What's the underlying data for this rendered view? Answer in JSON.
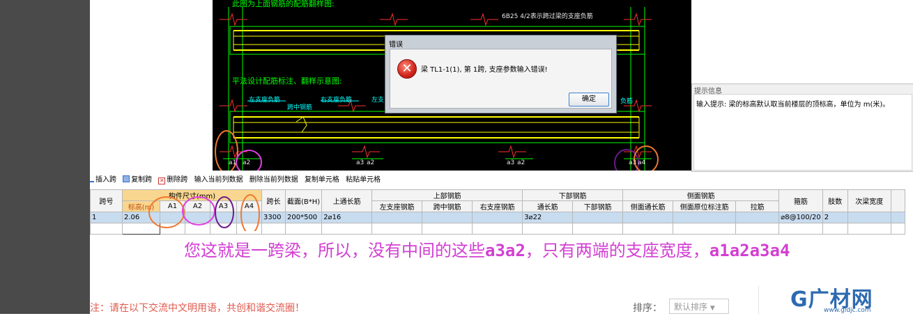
{
  "cad": {
    "top_caption": "此图为上面钢筋的配筋翻样图:",
    "top_note": "6B25 4/2表示跨过梁的支座负筋",
    "mid_caption": "平法设计配筋标注、翻样示意图:",
    "left_support": "左支座负筋",
    "right_support": "右支座负筋",
    "right_support_trunc": "左支",
    "span_mid": "跨中钢筋",
    "right_neg_trunc": "负筋",
    "labels": [
      "a1",
      "a2",
      "a3",
      "a2",
      "a3",
      "a2",
      "a3",
      "a4"
    ]
  },
  "hint": {
    "title": "提示信息",
    "text": "输入提示: 梁的标高默认取当前楼层的顶标高，单位为 m(米)。"
  },
  "dialog": {
    "title": "错误",
    "message": "梁 TL1-1(1), 第 1跨, 支座参数输入错误!",
    "ok": "确定"
  },
  "toolbar": [
    "插入跨",
    "复制跨",
    "删除跨",
    "输入当前列数据",
    "删除当前列数据",
    "复制单元格",
    "粘贴单元格"
  ],
  "grid": {
    "h_span": "跨号",
    "h_dims": "构件尺寸(mm)",
    "h_elev": "标高(m)",
    "h_a1": "A1",
    "h_a2": "A2",
    "h_a3": "A3",
    "h_a4": "A4",
    "h_len": "跨长",
    "h_sec": "截面(B*H)",
    "h_through": "上通长筋",
    "h_top": "上部钢筋",
    "h_top_l": "左支座钢筋",
    "h_top_m": "跨中钢筋",
    "h_top_r": "右支座钢筋",
    "h_bot": "下部钢筋",
    "h_bot_t": "通长筋",
    "h_bot_b": "下部钢筋",
    "h_side": "侧面钢筋",
    "h_side_t": "侧面通长筋",
    "h_side_o": "侧面原位标注筋",
    "h_side_tie": "拉筋",
    "h_stir": "箍筋",
    "h_legs": "肢数",
    "h_sec_w": "次梁宽度",
    "row": {
      "span": "1",
      "elev": "2.06",
      "len": "3300",
      "sec": "200*500",
      "through": "2⌀16",
      "bot_t": "3⌀22",
      "stir": "⌀8@100/20",
      "legs": "2"
    }
  },
  "annotation": {
    "text1": "您这就是一跨梁，所以，没有中间的这些",
    "code1": "a3a2",
    "text2": "，只有两端的支座宽度，",
    "code2": "a1a2a3a4"
  },
  "footer": {
    "note": "注：请在以下交流中文明用语，共创和谐交流圈！",
    "sort_label": "排序：",
    "sort_value": "默认排序"
  },
  "logo": {
    "main": "G广材网",
    "url": "www.gldjc.com"
  },
  "colors": {
    "cad_bg": "#000000",
    "cad_green": "#00ff00",
    "cad_yellow": "#ffff00",
    "cad_red": "#ff3030",
    "annotation": "#d23fd2",
    "orange_circle": "#f07830",
    "magenta_circle": "#e040e0",
    "purple_circle": "#6a1b8a"
  }
}
